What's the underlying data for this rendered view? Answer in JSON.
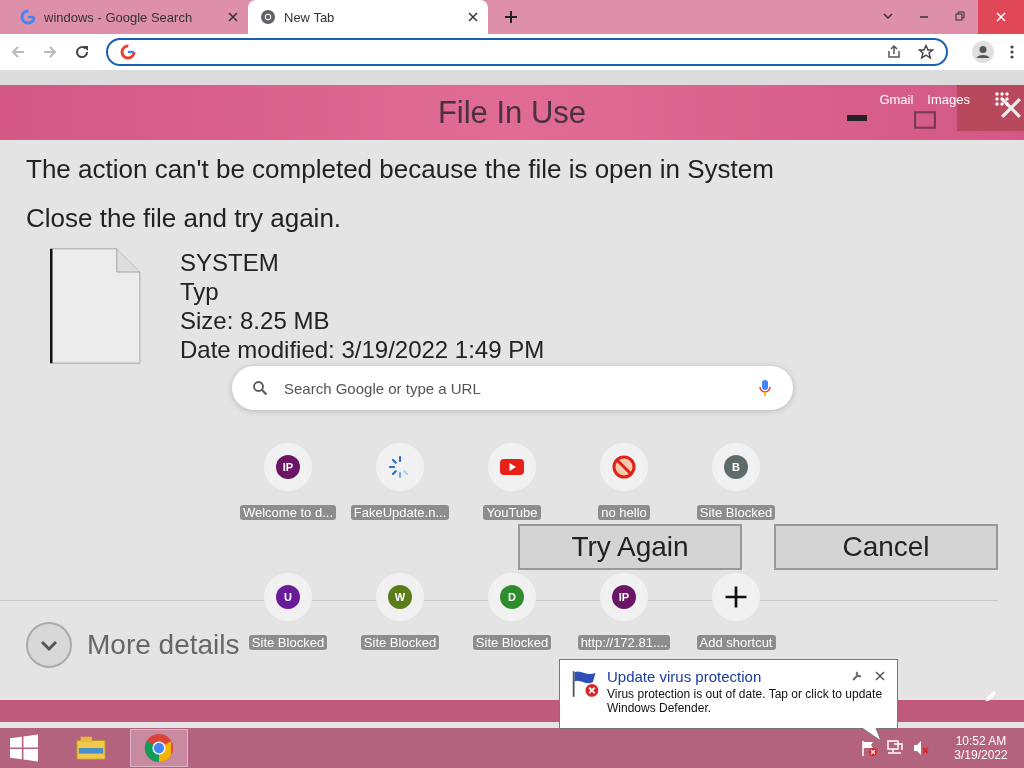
{
  "browser": {
    "tabs": [
      {
        "title": "windows - Google Search",
        "selected": false,
        "kind": "google"
      },
      {
        "title": "New Tab",
        "selected": true,
        "kind": "chrome"
      }
    ]
  },
  "background_dialog": {
    "title": "File In Use",
    "message": "The action can't be completed because the file is open in System",
    "instruction": "Close the file and try again.",
    "file_details": [
      "SYSTEM",
      "Typ",
      "Size: 8.25 MB",
      "Date modified: 3/19/2022 1:49 PM"
    ],
    "buttons": [
      "Try Again",
      "Cancel"
    ],
    "more_details": "More details"
  },
  "new_tab_page": {
    "links": [
      "Gmail",
      "Images"
    ],
    "search": {
      "placeholder": "Search Google or type a URL"
    },
    "shortcuts": [
      {
        "label": "Welcome to d...",
        "kind": "letter",
        "letter": "IP",
        "color": "#6b1566"
      },
      {
        "label": "FakeUpdate.n...",
        "kind": "spinner"
      },
      {
        "label": "YouTube",
        "kind": "youtube"
      },
      {
        "label": "no hello",
        "kind": "blocked"
      },
      {
        "label": "Site Blocked",
        "kind": "letter",
        "letter": "B",
        "color": "#5f6b6b"
      },
      {
        "label": "Site Blocked",
        "kind": "letter",
        "letter": "U",
        "color": "#6a1b9a"
      },
      {
        "label": "Site Blocked",
        "kind": "letter",
        "letter": "W",
        "color": "#5a7d1a"
      },
      {
        "label": "Site Blocked",
        "kind": "letter",
        "letter": "D",
        "color": "#2e8b2e"
      },
      {
        "label": "http://172.81....",
        "kind": "letter",
        "letter": "IP",
        "color": "#6b1566"
      },
      {
        "label": "Add shortcut",
        "kind": "add"
      }
    ]
  },
  "notification": {
    "title": "Update virus protection",
    "body": "Virus protection is out of date. Tap or click to update Windows Defender."
  },
  "taskbar": {
    "apps": [
      {
        "kind": "explorer",
        "selected": false
      },
      {
        "kind": "chrome",
        "selected": true
      }
    ],
    "clock": {
      "time": "10:52 AM",
      "date": "3/19/2022"
    }
  }
}
